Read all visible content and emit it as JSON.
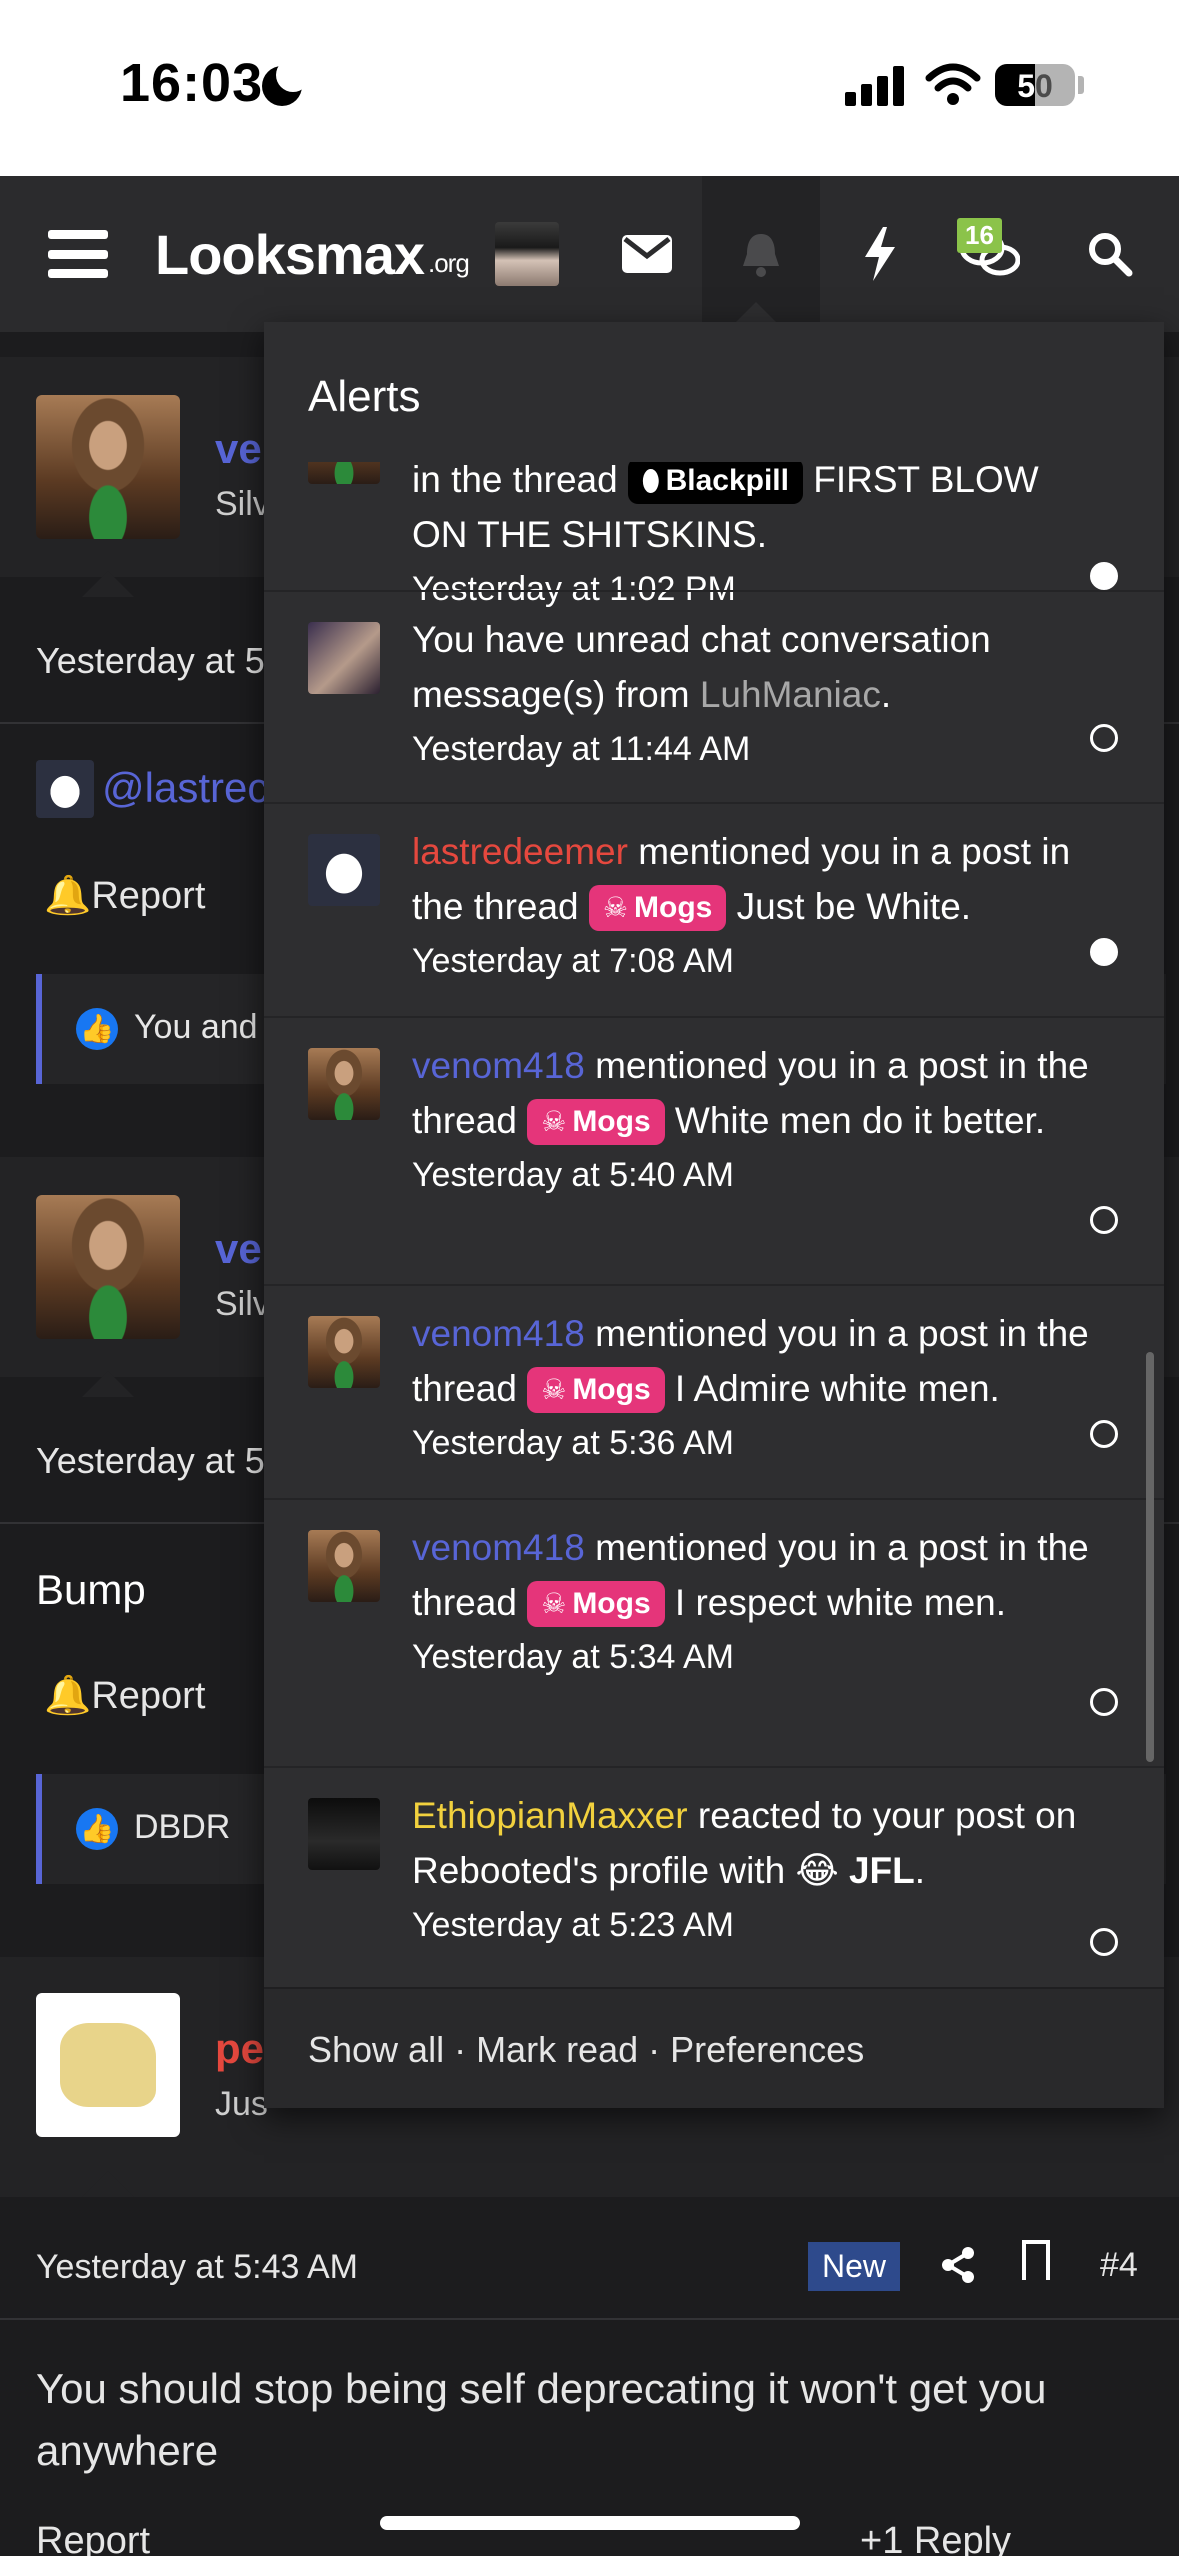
{
  "status_bar": {
    "time": "16:03",
    "battery": "50"
  },
  "nav": {
    "logo": "Looksmax",
    "logo_suffix": ".org",
    "chat_badge": "16"
  },
  "background": {
    "post1": {
      "name": "ve",
      "subtitle": "Silv",
      "date": "Yesterday at 5",
      "mention": "@lastrec",
      "report": "Report",
      "likes": "You and"
    },
    "post2": {
      "name": "ve",
      "subtitle": "Silv",
      "date": "Yesterday at 5",
      "body": "Bump",
      "report": "Report",
      "likes": "DBDR"
    },
    "post3": {
      "name": "pe",
      "subtitle": "Jus"
    },
    "post4": {
      "date": "Yesterday at 5:43 AM",
      "new_badge": "New",
      "number": "#4",
      "body": "You should stop being self deprecating it won't get you anywhere",
      "report": "Report",
      "actions": "+1 Reply"
    }
  },
  "alerts": {
    "title": "Alerts",
    "items": [
      {
        "pre": "in the thread",
        "prefix": "Blackpill",
        "rest": "FIRST BLOW ON THE SHITSKINS.",
        "time": "Yesterday at 1:02 PM",
        "unread": true
      },
      {
        "pre": "You have unread chat conversation message(s) from",
        "user": "LuhManiac",
        "rest": ".",
        "time": "Yesterday at 11:44 AM",
        "unread": false
      },
      {
        "user": "lastredeemer",
        "action": "mentioned you in a post in the thread",
        "prefix": "Mogs",
        "rest": "Just be White.",
        "time": "Yesterday at 7:08 AM",
        "unread": true
      },
      {
        "user": "venom418",
        "action": "mentioned you in a post in the thread",
        "prefix": "Mogs",
        "rest": "White men do it better.",
        "time": "Yesterday at 5:40 AM",
        "unread": false
      },
      {
        "user": "venom418",
        "action": "mentioned you in a post in the thread",
        "prefix": "Mogs",
        "rest": "I Admire white men.",
        "time": "Yesterday at 5:36 AM",
        "unread": false
      },
      {
        "user": "venom418",
        "action": "mentioned you in a post in the thread",
        "prefix": "Mogs",
        "rest": "I respect white men.",
        "time": "Yesterday at 5:34 AM",
        "unread": false
      },
      {
        "user": "EthiopianMaxxer",
        "action": "reacted to your post on Rebooted's profile with",
        "reaction": "JFL",
        "rest": ".",
        "time": "Yesterday at 5:23 AM",
        "unread": false
      }
    ],
    "footer": "Show all · Mark read · Preferences"
  },
  "colors": {
    "accent": "#5865d6",
    "mogs_prefix": "#e5357a",
    "unread_badge": "#8bc34a"
  }
}
